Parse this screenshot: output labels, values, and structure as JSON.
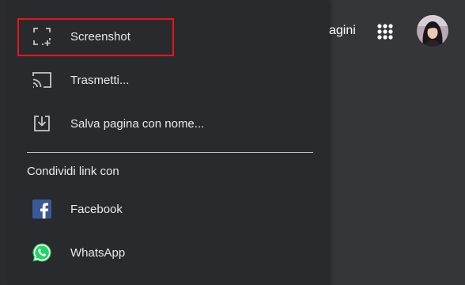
{
  "header": {
    "partial_text": "agini"
  },
  "menu": {
    "items": [
      {
        "label": "Screenshot",
        "icon": "screenshot-icon"
      },
      {
        "label": "Trasmetti...",
        "icon": "cast-icon"
      },
      {
        "label": "Salva pagina con nome...",
        "icon": "save-page-icon"
      }
    ],
    "share_section_title": "Condividi link con",
    "share_items": [
      {
        "label": "Facebook",
        "icon": "facebook-icon"
      },
      {
        "label": "WhatsApp",
        "icon": "whatsapp-icon"
      }
    ]
  },
  "colors": {
    "menu_bg": "#292a2d",
    "page_bg": "#35363a",
    "text": "#e8eaed",
    "highlight": "#e8141c",
    "facebook": "#3b5998",
    "whatsapp": "#25d366"
  }
}
